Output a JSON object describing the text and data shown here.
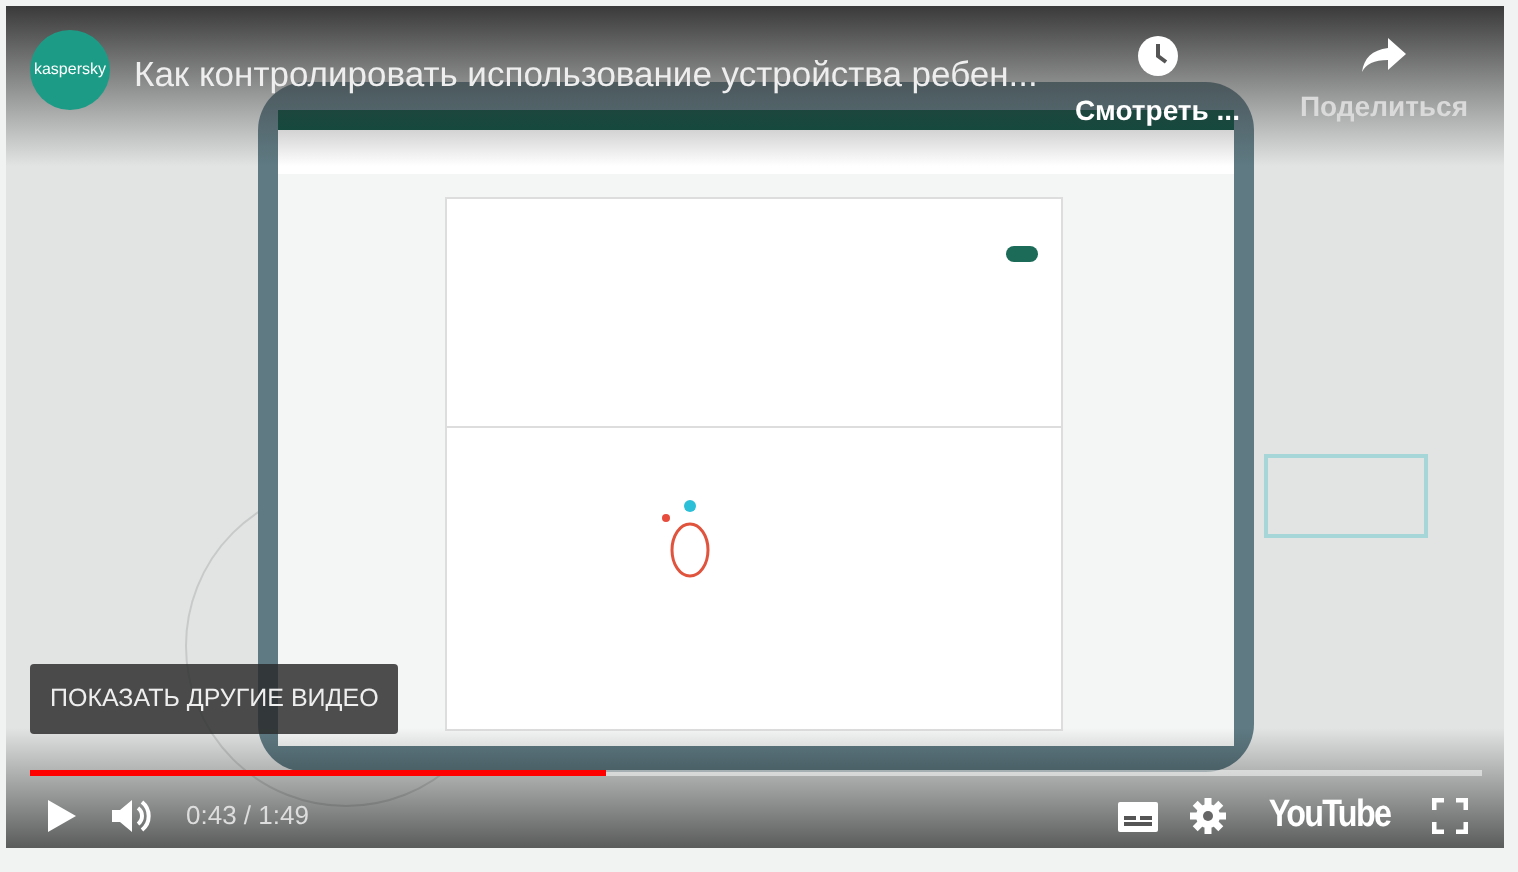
{
  "header": {
    "channel_logo": "kaspersky",
    "title": "Как контролировать использование устройства ребен...",
    "actions": [
      {
        "kind": "clock",
        "label": "Смотреть ..."
      },
      {
        "kind": "share",
        "label": "Поделиться"
      }
    ]
  },
  "more_videos_button": "ПОКАЗАТЬ ДРУГИЕ ВИДЕО",
  "progress": {
    "level": 0.397
  },
  "controls": {
    "time": "0:43 / 1:49",
    "logo": "YouTube"
  }
}
